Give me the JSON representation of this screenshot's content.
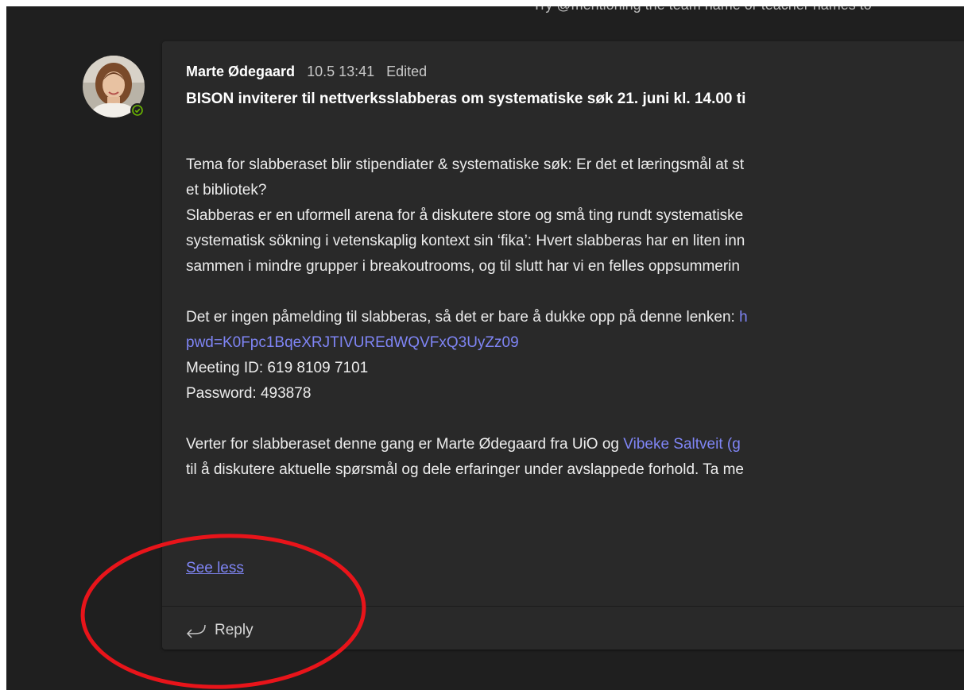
{
  "top_hint": "Try @mentioning the team name or teacher names to",
  "message": {
    "author": "Marte Ødegaard",
    "timestamp": "10.5 13:41",
    "edited_label": "Edited",
    "subject": "BISON inviterer til nettverksslabberas om systematiske søk 21. juni kl. 14.00 ti",
    "body": {
      "p1_line1": "Tema for slabberaset blir stipendiater & systematiske søk: Er det et læringsmål at st",
      "p1_line2": "et bibliotek?",
      "p1_line3": "Slabberas er en uformell arena for å diskutere store og små ting rundt systematiske",
      "p1_line4": "systematisk sökning i vetenskaplig kontext sin ‘fika’: Hvert slabberas har en liten inn",
      "p1_line5": "sammen i mindre grupper i breakoutrooms, og til slutt har vi en felles oppsummerin",
      "p2_line1_text": "Det er ingen påmelding til slabberas, så det er bare å dukke opp på denne lenken: ",
      "p2_line1_link": "h",
      "p2_line2_link": "pwd=K0Fpc1BqeXRJTIVUREdWQVFxQ3UyZz09",
      "meeting_id": "Meeting ID: 619 8109 7101",
      "password": "Password: 493878",
      "p3_line1_text": "Verter for slabberaset denne gang er Marte Ødegaard fra UiO og ",
      "p3_line1_link": "Vibeke Saltveit (g",
      "p3_line2": "til å diskutere aktuelle spørsmål og dele erfaringer under avslappede forhold. Ta me"
    },
    "see_less_label": "See less",
    "reply_label": "Reply"
  },
  "colors": {
    "background": "#1f1f1f",
    "card": "#292929",
    "link": "#7f85f5",
    "presence_available": "#6bb700",
    "annotation_circle": "#e8141a"
  },
  "icons": {
    "presence": "available-check-icon",
    "reply": "reply-arrow-icon"
  }
}
